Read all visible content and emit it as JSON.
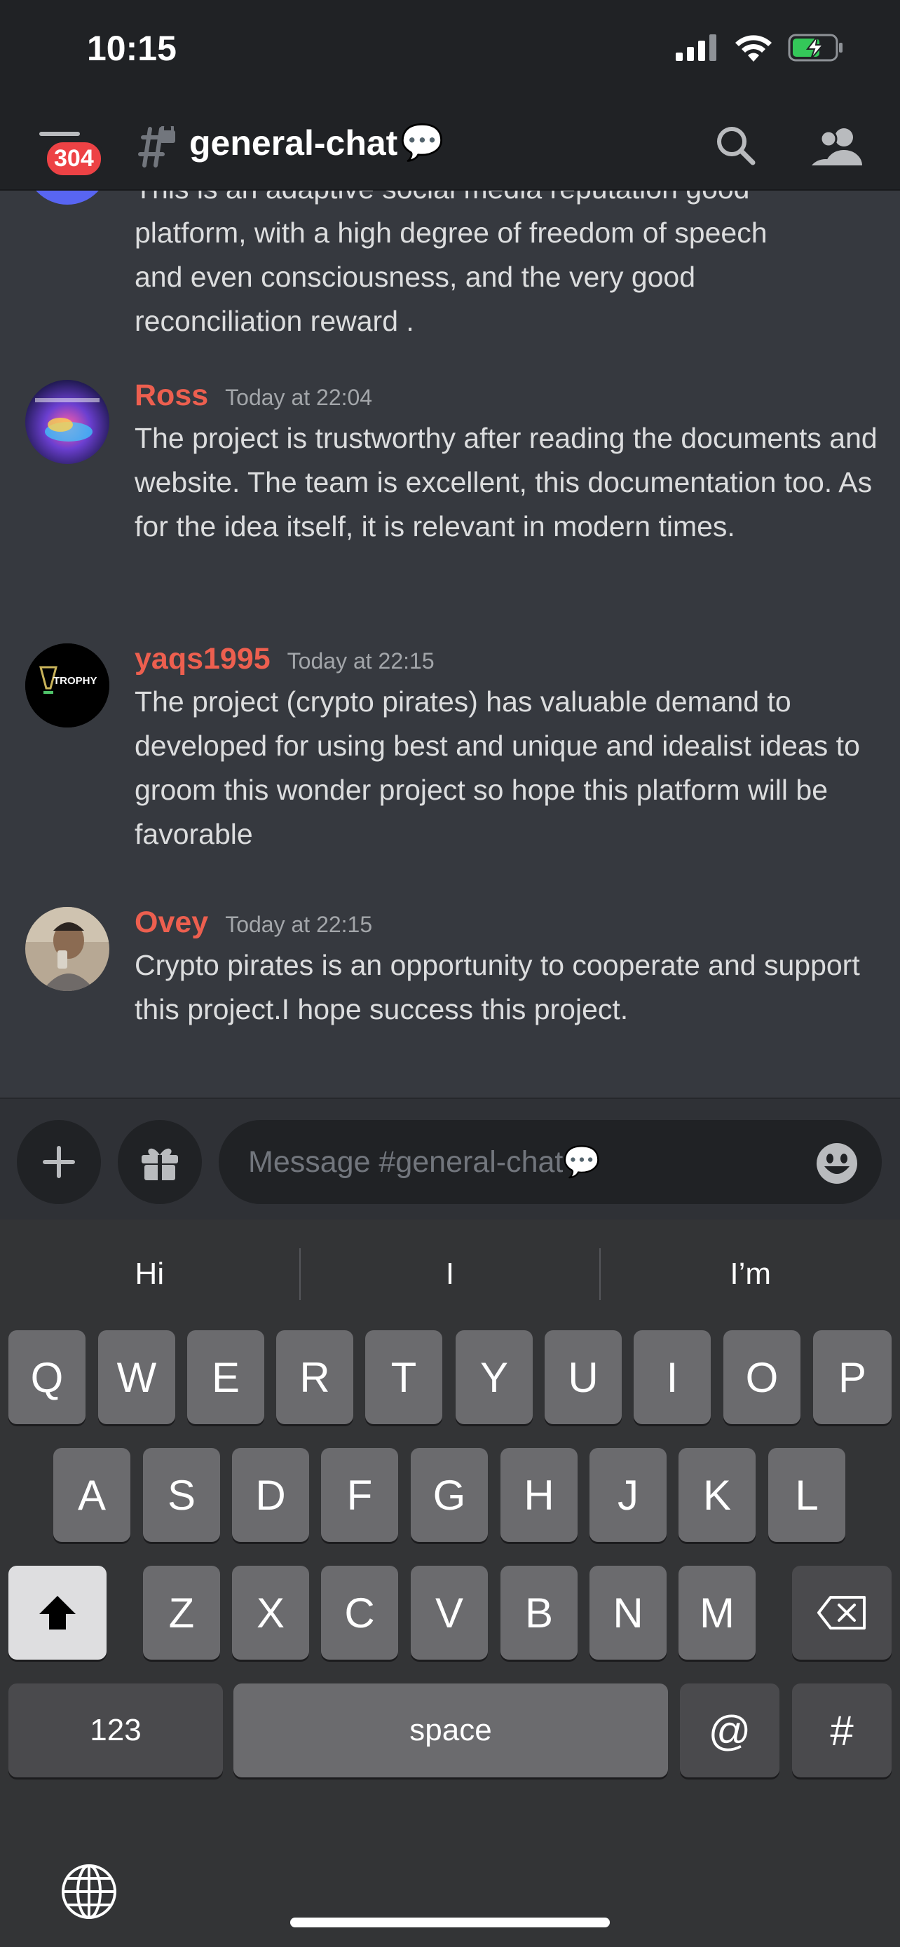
{
  "status_bar": {
    "time": "10:15"
  },
  "header": {
    "unread_badge": "304",
    "channel_name": "general-chat",
    "channel_emoji": "💬"
  },
  "messages": {
    "partial": {
      "lines": [
        "This is an adaptive social media reputation good",
        "platform, with a high degree of freedom of speech",
        "and even consciousness, and the very good",
        "reconciliation reward ."
      ]
    },
    "items": [
      {
        "author": "Ross",
        "timestamp": "Today at 22:04",
        "text": "The project is trustworthy after reading the documents and website. The team is excellent, this documentation too. As for the idea itself, it is relevant in modern times."
      },
      {
        "author": "yaqs1995",
        "timestamp": "Today at 22:15",
        "avatar_text": "TROPHY",
        "text": "The project (crypto pirates) has valuable demand to developed for using best and unique and idealist ideas to groom this wonder project so hope this platform will be favorable"
      },
      {
        "author": "Ovey",
        "timestamp": "Today at 22:15",
        "text": "Crypto pirates is an opportunity to cooperate and support this project.I hope success this project."
      }
    ]
  },
  "composer": {
    "placeholder": "Message #general-chat💬"
  },
  "keyboard": {
    "suggestions": [
      "Hi",
      "I",
      "I’m"
    ],
    "row1": [
      "Q",
      "W",
      "E",
      "R",
      "T",
      "Y",
      "U",
      "I",
      "O",
      "P"
    ],
    "row2": [
      "A",
      "S",
      "D",
      "F",
      "G",
      "H",
      "J",
      "K",
      "L"
    ],
    "row3": [
      "Z",
      "X",
      "C",
      "V",
      "B",
      "N",
      "M"
    ],
    "numbers_label": "123",
    "space_label": "space",
    "at_label": "@",
    "hash_label": "#"
  },
  "colors": {
    "background": "#36393f",
    "header": "#202225",
    "author": "#ed5f4f",
    "badge": "#ed4245"
  },
  "icons": [
    "hamburger-menu-icon",
    "locked-channel-icon",
    "search-icon",
    "members-icon",
    "plus-icon",
    "gift-icon",
    "emoji-icon",
    "shift-icon",
    "backspace-icon",
    "globe-icon"
  ]
}
